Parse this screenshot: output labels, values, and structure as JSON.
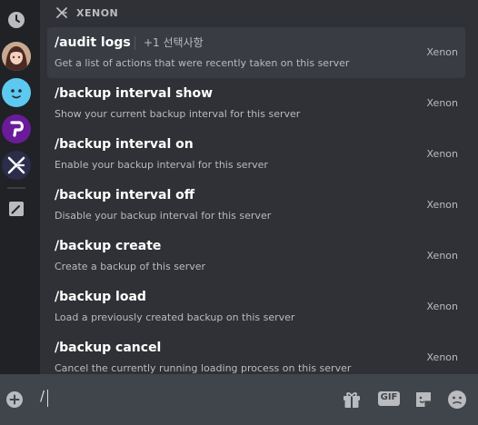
{
  "bot": {
    "name": "XENON"
  },
  "commands": [
    {
      "name": "/audit logs",
      "extra": "+1 선택사항",
      "description": "Get a list of actions that were recently taken on this server",
      "bot": "Xenon"
    },
    {
      "name": "/backup interval show",
      "extra": "",
      "description": "Show your current backup interval for this server",
      "bot": "Xenon"
    },
    {
      "name": "/backup interval on",
      "extra": "",
      "description": "Enable your backup interval for this server",
      "bot": "Xenon"
    },
    {
      "name": "/backup interval off",
      "extra": "",
      "description": "Disable your backup interval for this server",
      "bot": "Xenon"
    },
    {
      "name": "/backup create",
      "extra": "",
      "description": "Create a backup of this server",
      "bot": "Xenon"
    },
    {
      "name": "/backup load",
      "extra": "",
      "description": "Load a previously created backup on this server",
      "bot": "Xenon"
    },
    {
      "name": "/backup cancel",
      "extra": "",
      "description": "Cancel the currently running loading process on this server",
      "bot": "Xenon"
    }
  ],
  "input": {
    "value": "/"
  },
  "rail": {
    "items": [
      {
        "icon": "clock-icon"
      },
      {
        "icon": "avatar-anime"
      },
      {
        "icon": "avatar-smiley"
      },
      {
        "icon": "avatar-p-logo"
      },
      {
        "icon": "xenon-logo"
      },
      {
        "icon": "pencil-icon"
      }
    ]
  },
  "colors": {
    "accent": "#5865f2",
    "purple": "#6a1b9a",
    "cyan": "#5dc9f0",
    "selected": "#393c43"
  },
  "toolbar": {
    "gif_label": "GIF"
  }
}
